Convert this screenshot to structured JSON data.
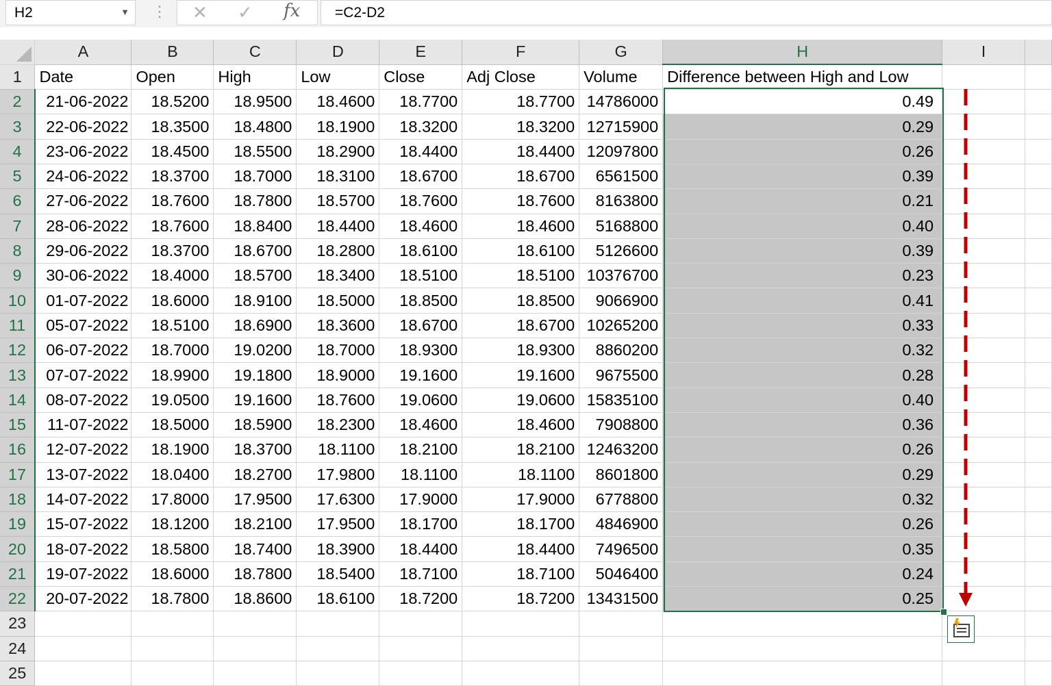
{
  "formula_bar": {
    "name_box": "H2",
    "cancel_icon": "✕",
    "enter_icon": "✓",
    "fx_label": "fx",
    "formula": "=C2-D2"
  },
  "columns": [
    "A",
    "B",
    "C",
    "D",
    "E",
    "F",
    "G",
    "H",
    "I"
  ],
  "selected_column": "H",
  "header_row": {
    "row_number": "1",
    "cells": [
      "Date",
      "Open",
      "High",
      "Low",
      "Close",
      "Adj Close",
      "Volume",
      "Difference between High and Low",
      ""
    ]
  },
  "rows": [
    {
      "n": "2",
      "date": "21-06-2022",
      "open": "18.5200",
      "high": "18.9500",
      "low": "18.4600",
      "close": "18.7700",
      "adj": "18.7700",
      "vol": "14786000",
      "diff": "0.49"
    },
    {
      "n": "3",
      "date": "22-06-2022",
      "open": "18.3500",
      "high": "18.4800",
      "low": "18.1900",
      "close": "18.3200",
      "adj": "18.3200",
      "vol": "12715900",
      "diff": "0.29"
    },
    {
      "n": "4",
      "date": "23-06-2022",
      "open": "18.4500",
      "high": "18.5500",
      "low": "18.2900",
      "close": "18.4400",
      "adj": "18.4400",
      "vol": "12097800",
      "diff": "0.26"
    },
    {
      "n": "5",
      "date": "24-06-2022",
      "open": "18.3700",
      "high": "18.7000",
      "low": "18.3100",
      "close": "18.6700",
      "adj": "18.6700",
      "vol": "6561500",
      "diff": "0.39"
    },
    {
      "n": "6",
      "date": "27-06-2022",
      "open": "18.7600",
      "high": "18.7800",
      "low": "18.5700",
      "close": "18.7600",
      "adj": "18.7600",
      "vol": "8163800",
      "diff": "0.21"
    },
    {
      "n": "7",
      "date": "28-06-2022",
      "open": "18.7600",
      "high": "18.8400",
      "low": "18.4400",
      "close": "18.4600",
      "adj": "18.4600",
      "vol": "5168800",
      "diff": "0.40"
    },
    {
      "n": "8",
      "date": "29-06-2022",
      "open": "18.3700",
      "high": "18.6700",
      "low": "18.2800",
      "close": "18.6100",
      "adj": "18.6100",
      "vol": "5126600",
      "diff": "0.39"
    },
    {
      "n": "9",
      "date": "30-06-2022",
      "open": "18.4000",
      "high": "18.5700",
      "low": "18.3400",
      "close": "18.5100",
      "adj": "18.5100",
      "vol": "10376700",
      "diff": "0.23"
    },
    {
      "n": "10",
      "date": "01-07-2022",
      "open": "18.6000",
      "high": "18.9100",
      "low": "18.5000",
      "close": "18.8500",
      "adj": "18.8500",
      "vol": "9066900",
      "diff": "0.41"
    },
    {
      "n": "11",
      "date": "05-07-2022",
      "open": "18.5100",
      "high": "18.6900",
      "low": "18.3600",
      "close": "18.6700",
      "adj": "18.6700",
      "vol": "10265200",
      "diff": "0.33"
    },
    {
      "n": "12",
      "date": "06-07-2022",
      "open": "18.7000",
      "high": "19.0200",
      "low": "18.7000",
      "close": "18.9300",
      "adj": "18.9300",
      "vol": "8860200",
      "diff": "0.32"
    },
    {
      "n": "13",
      "date": "07-07-2022",
      "open": "18.9900",
      "high": "19.1800",
      "low": "18.9000",
      "close": "19.1600",
      "adj": "19.1600",
      "vol": "9675500",
      "diff": "0.28"
    },
    {
      "n": "14",
      "date": "08-07-2022",
      "open": "19.0500",
      "high": "19.1600",
      "low": "18.7600",
      "close": "19.0600",
      "adj": "19.0600",
      "vol": "15835100",
      "diff": "0.40"
    },
    {
      "n": "15",
      "date": "11-07-2022",
      "open": "18.5000",
      "high": "18.5900",
      "low": "18.2300",
      "close": "18.4600",
      "adj": "18.4600",
      "vol": "7908800",
      "diff": "0.36"
    },
    {
      "n": "16",
      "date": "12-07-2022",
      "open": "18.1900",
      "high": "18.3700",
      "low": "18.1100",
      "close": "18.2100",
      "adj": "18.2100",
      "vol": "12463200",
      "diff": "0.26"
    },
    {
      "n": "17",
      "date": "13-07-2022",
      "open": "18.0400",
      "high": "18.2700",
      "low": "17.9800",
      "close": "18.1100",
      "adj": "18.1100",
      "vol": "8601800",
      "diff": "0.29"
    },
    {
      "n": "18",
      "date": "14-07-2022",
      "open": "17.8000",
      "high": "17.9500",
      "low": "17.6300",
      "close": "17.9000",
      "adj": "17.9000",
      "vol": "6778800",
      "diff": "0.32"
    },
    {
      "n": "19",
      "date": "15-07-2022",
      "open": "18.1200",
      "high": "18.2100",
      "low": "17.9500",
      "close": "18.1700",
      "adj": "18.1700",
      "vol": "4846900",
      "diff": "0.26"
    },
    {
      "n": "20",
      "date": "18-07-2022",
      "open": "18.5800",
      "high": "18.7400",
      "low": "18.3900",
      "close": "18.4400",
      "adj": "18.4400",
      "vol": "7496500",
      "diff": "0.35"
    },
    {
      "n": "21",
      "date": "19-07-2022",
      "open": "18.6000",
      "high": "18.7800",
      "low": "18.5400",
      "close": "18.7100",
      "adj": "18.7100",
      "vol": "5046400",
      "diff": "0.24"
    },
    {
      "n": "22",
      "date": "20-07-2022",
      "open": "18.7800",
      "high": "18.8600",
      "low": "18.6100",
      "close": "18.7200",
      "adj": "18.7200",
      "vol": "13431500",
      "diff": "0.25"
    }
  ],
  "empty_rows": [
    "23",
    "24",
    "25"
  ],
  "colors": {
    "selection_green": "#217346",
    "selected_fill": "#c6c6c6",
    "arrow_red": "#c00000"
  },
  "icons": {
    "fill_arrow": "dashed-down-arrow-icon",
    "quick_analysis": "quick-analysis-icon"
  }
}
